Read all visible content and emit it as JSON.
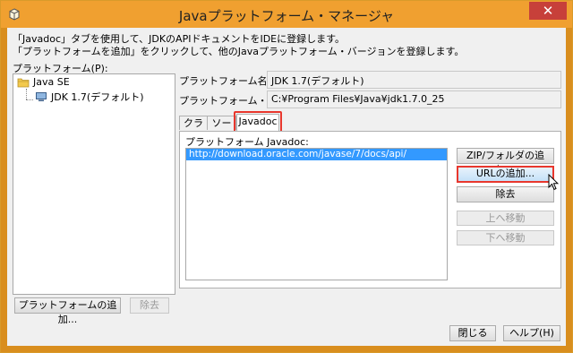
{
  "window": {
    "title": "Javaプラットフォーム・マネージャ",
    "close_glyph": "✕"
  },
  "intro": {
    "line1": "「Javadoc」タブを使用して、JDKのAPIドキュメントをIDEに登録します。",
    "line2": "「プラットフォームを追加」をクリックして、他のJavaプラットフォーム・バージョンを登録します。"
  },
  "platforms": {
    "label": "プラットフォーム(P):",
    "tree": [
      {
        "label": "Java SE",
        "icon": "folder-icon"
      },
      {
        "label": "JDK 1.7(デフォルト)",
        "icon": "platform-icon"
      }
    ],
    "add_button": "プラットフォームの追加...",
    "remove_button": "除去"
  },
  "details": {
    "name_label": "プラットフォーム名:",
    "name_value": "JDK 1.7(デフォルト)",
    "folder_label": "プラットフォーム・フォルダ:",
    "folder_value": "C:¥Program Files¥Java¥jdk1.7.0_25"
  },
  "tabs": [
    {
      "label": "クラス",
      "active": false
    },
    {
      "label": "ソース",
      "active": false
    },
    {
      "label": "Javadoc",
      "active": true
    }
  ],
  "javadoc": {
    "label": "プラットフォーム Javadoc:",
    "items": [
      "http://download.oracle.com/javase/7/docs/api/"
    ],
    "buttons": {
      "add_zip": "ZIP/フォルダの追加...",
      "add_url": "URLの追加...",
      "remove": "除去",
      "move_up": "上へ移動",
      "move_down": "下へ移動"
    }
  },
  "footer": {
    "close": "閉じる",
    "help": "ヘルプ(H)"
  },
  "colors": {
    "title_bar": "#f0a030",
    "highlight": "#e8372d",
    "selection": "#3399ff"
  }
}
